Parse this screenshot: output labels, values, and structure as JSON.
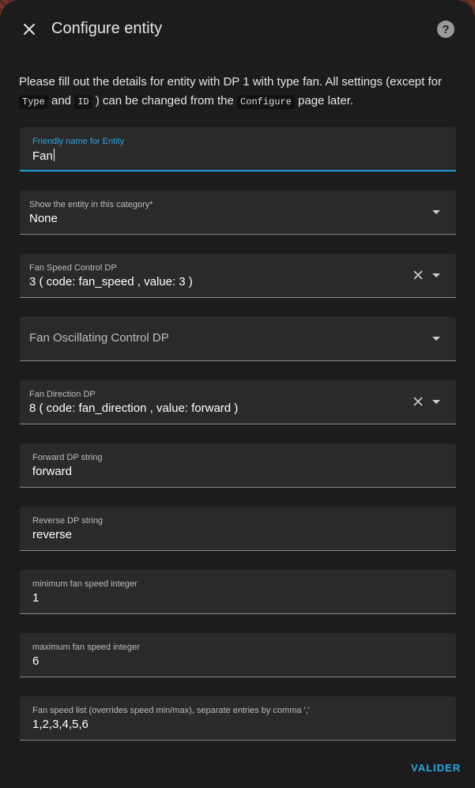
{
  "dialog": {
    "title": "Configure entity",
    "help_icon": "question-icon",
    "close_icon": "close-icon",
    "description": {
      "part1": "Please fill out the details for entity with DP 1 with type fan. All settings (except for ",
      "code1": "Type",
      "part2": " and ",
      "code2": "ID",
      "part3": " ) can be changed from the ",
      "code3": "Configure",
      "part4": " page later."
    }
  },
  "fields": {
    "friendly_name": {
      "label": "Friendly name for Entity",
      "value": "Fan"
    },
    "category": {
      "label": "Show the entity in this category*",
      "value": "None"
    },
    "speed_dp": {
      "label": "Fan Speed Control DP",
      "value": "3 ( code: fan_speed , value: 3 )"
    },
    "oscillating_dp": {
      "placeholder": "Fan Oscillating Control DP"
    },
    "direction_dp": {
      "label": "Fan Direction DP",
      "value": "8 ( code: fan_direction , value: forward )"
    },
    "forward_string": {
      "label": "Forward DP string",
      "value": "forward"
    },
    "reverse_string": {
      "label": "Reverse DP string",
      "value": "reverse"
    },
    "min_speed": {
      "label": "minimum fan speed integer",
      "value": "1"
    },
    "max_speed": {
      "label": "maximum fan speed integer",
      "value": "6"
    },
    "speed_list": {
      "label": "Fan speed list (overrides speed min/max), separate entries by comma ',' ",
      "value": "1,2,3,4,5,6"
    }
  },
  "footer": {
    "submit_label": "VALIDER"
  },
  "colors": {
    "accent": "#2aa6e0",
    "surface": "#1c1c1c",
    "field_bg": "#2a2a2a"
  }
}
